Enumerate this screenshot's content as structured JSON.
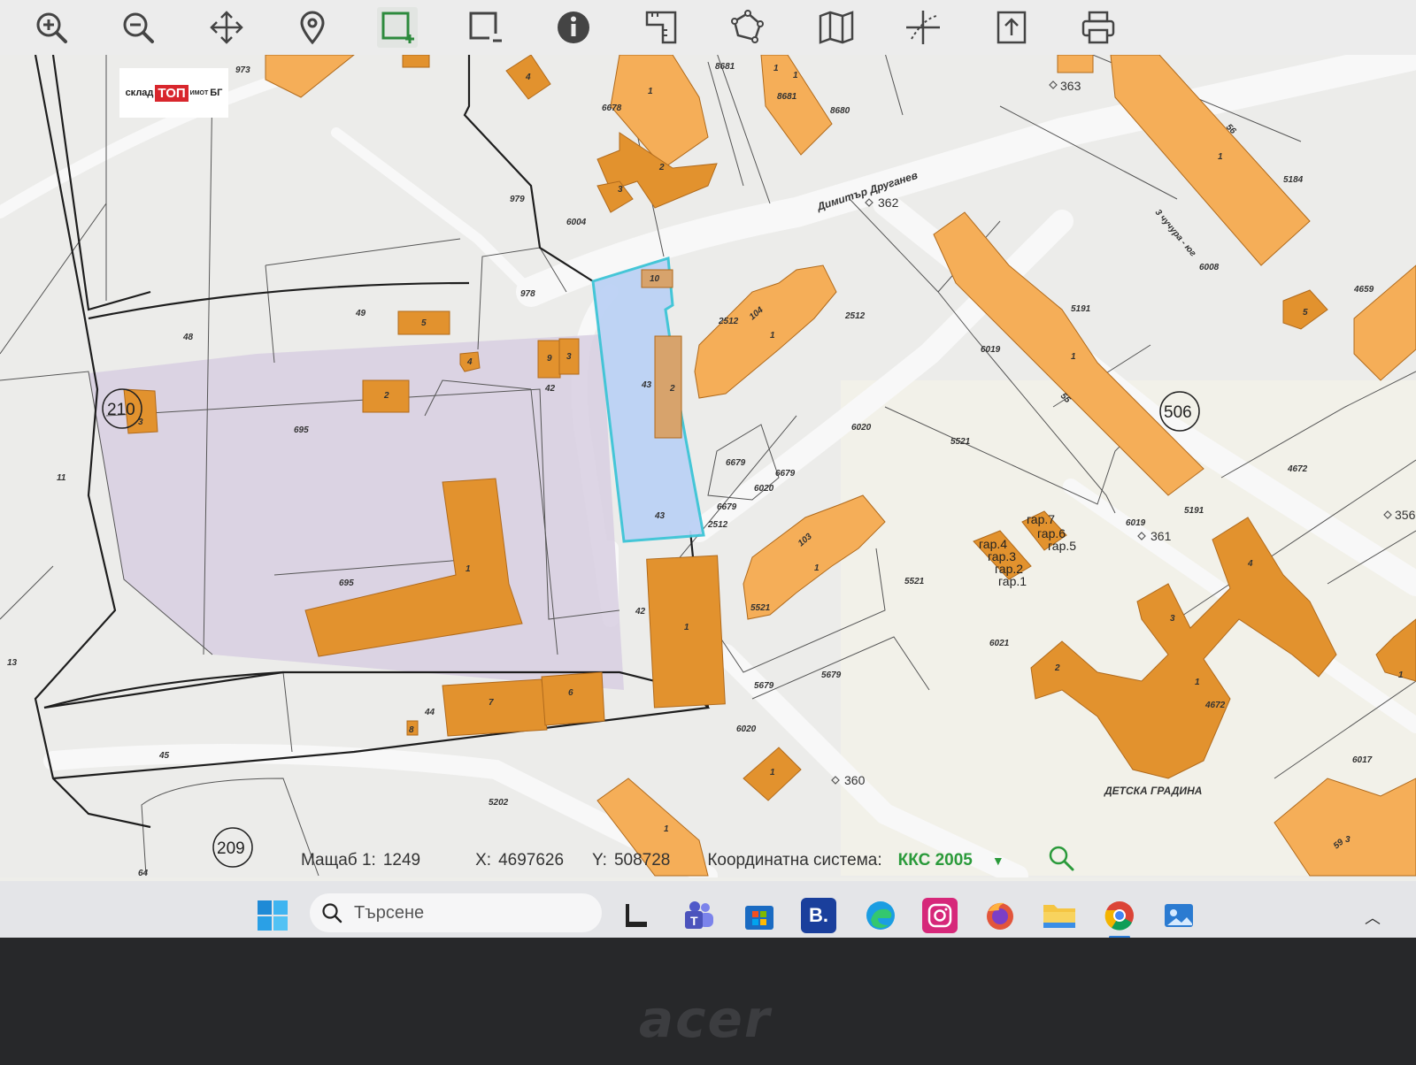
{
  "toolbar": {
    "tools": [
      "zoom-in-icon",
      "zoom-out-icon",
      "pan-icon",
      "location-pin-icon",
      "select-area-icon",
      "deselect-area-icon",
      "info-icon",
      "measure-icon",
      "polygon-icon",
      "map-layers-icon",
      "coordinates-icon",
      "export-icon",
      "print-icon"
    ]
  },
  "logo": {
    "left": "склад",
    "mid": "ТОП",
    "sub": "ИМОТ",
    "right": "БГ"
  },
  "map": {
    "labels": {
      "l973": "973",
      "l8681a": "8681",
      "l8681b": "8681",
      "l8680": "8680",
      "l6678": "6678",
      "l979": "979",
      "l6004": "6004",
      "l978": "978",
      "l363": "363",
      "l362": "362",
      "street1": "Димитър Друганев",
      "street2": "3 чучура - юг",
      "l6008": "6008",
      "l5184": "5184",
      "l4659": "4659",
      "l5191a": "5191",
      "l5191b": "5191",
      "l6019a": "6019",
      "l6019b": "6019",
      "l2512a": "2512",
      "l2512b": "2512",
      "l2512c": "2512",
      "l104": "104",
      "l49": "49",
      "l48": "48",
      "l210": "210",
      "l506": "506",
      "l209": "209",
      "l695a": "695",
      "l695b": "695",
      "l42a": "42",
      "l42b": "42",
      "l43a": "43",
      "l43b": "43",
      "l6020a": "6020",
      "l6020b": "6020",
      "l6020c": "6020",
      "l5521a": "5521",
      "l5521b": "5521",
      "l5521c": "5521",
      "l6679a": "6679",
      "l6679b": "6679",
      "l6679c": "6679",
      "l5679a": "5679",
      "l5679b": "5679",
      "l6021": "6021",
      "l4672a": "4672",
      "l4672b": "4672",
      "l6017": "6017",
      "l361": "361",
      "l356": "356",
      "l360": "360",
      "l5202": "5202",
      "l11": "11",
      "l13": "13",
      "l45": "45",
      "l44": "44",
      "l64": "64",
      "l103": "103",
      "l55": "55",
      "l56": "56",
      "l59": "59",
      "kinder": "ДЕТСКА ГРАДИНА",
      "gar1": "гар.1",
      "gar2": "гар.2",
      "gar3": "гар.3",
      "gar4": "гар.4",
      "gar5": "гар.5",
      "gar6": "гар.6",
      "gar7": "гар.7",
      "b1": "1",
      "b2": "2",
      "b3": "3",
      "b4": "4",
      "b5": "5",
      "b6": "6",
      "b7": "7",
      "b8": "8",
      "b9": "9",
      "b10": "10"
    }
  },
  "status": {
    "scale_label": "Мащаб 1:",
    "scale_value": "1249",
    "x_label": "X:",
    "x_value": "4697626",
    "y_label": "Y:",
    "y_value": "508728",
    "crs_label": "Координатна система:",
    "crs_value": "ККС 2005"
  },
  "taskbar": {
    "search_placeholder": "Търсене",
    "apps": [
      "start-icon",
      "task-view-icon",
      "teams-icon",
      "store-icon",
      "booking-icon",
      "edge-icon",
      "instagram-icon",
      "firefox-icon",
      "file-explorer-icon",
      "chrome-icon",
      "photos-icon"
    ],
    "booking_letter": "B."
  },
  "device": {
    "brand": "acer"
  },
  "colors": {
    "building": "#f5ae58",
    "building_dark": "#e2922e",
    "highlight": "#bcd2f5",
    "highlight_border": "#3cc4d6",
    "parcel_shade": "#d8cfe2",
    "crs_green": "#2a9a3a"
  }
}
